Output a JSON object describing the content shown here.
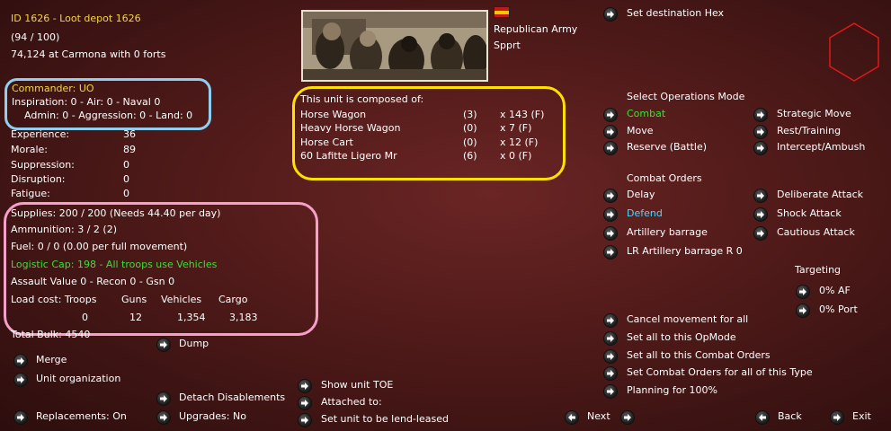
{
  "unit": {
    "id_line": "ID 1626 - Loot depot 1626",
    "strength": "(94 / 100)",
    "location": "74,124 at Carmona with 0 forts"
  },
  "commander": {
    "title": "Commander: UO",
    "line1": "Inspiration: 0 - Air: 0 - Naval 0",
    "line2": "Admin: 0 - Aggression: 0 - Land: 0"
  },
  "stats": [
    {
      "label": "Experience:",
      "value": "36"
    },
    {
      "label": "Morale:",
      "value": "89"
    },
    {
      "label": "Suppression:",
      "value": "0"
    },
    {
      "label": "Disruption:",
      "value": "0"
    },
    {
      "label": "Fatigue:",
      "value": "0"
    }
  ],
  "supply": {
    "supplies": "Supplies: 200 / 200 (Needs 44.40 per day)",
    "ammunition": "Ammunition: 3 / 2 (2)",
    "fuel": "Fuel: 0 / 0 (0.00 per full movement)",
    "logistic": "Logistic Cap: 198 - All troops use Vehicles",
    "assault": "Assault Value 0 - Recon 0 - Gsn 0",
    "load_header": [
      "Load cost: Troops",
      "Guns",
      "Vehicles",
      "Cargo"
    ],
    "load_values": [
      "0",
      "12",
      "1,354",
      "3,183"
    ]
  },
  "total_line": "Total Bulk: 4540",
  "nation": {
    "flag_color_top": "#c0181c",
    "flag_color_mid": "#f0c800",
    "line1": "Republican Army",
    "line2": "Spprt"
  },
  "composition": {
    "title": "This unit is composed of:",
    "rows": [
      {
        "name": "Horse Wagon",
        "count": "(3)",
        "qty": "x 143 (F)"
      },
      {
        "name": "Heavy Horse Wagon",
        "count": "(0)",
        "qty": "x 7 (F)"
      },
      {
        "name": "Horse Cart",
        "count": "(0)",
        "qty": "x 12 (F)"
      },
      {
        "name": "60 Lafitte Ligero Mr",
        "count": "(6)",
        "qty": "x 0 (F)"
      }
    ]
  },
  "left_actions": {
    "dump": "Dump",
    "merge": "Merge",
    "unit_org": "Unit organization",
    "detach": "Detach Disablements",
    "replacements": "Replacements: On",
    "upgrades": "Upgrades: No"
  },
  "mid_actions": {
    "show_toe": "Show unit TOE",
    "attached": "Attached to:",
    "lend_lease": "Set unit to be lend-leased"
  },
  "right": {
    "set_destination": "Set destination Hex",
    "ops_title": "Select Operations Mode",
    "ops_left": [
      "Combat",
      "Move",
      "Reserve (Battle)"
    ],
    "ops_right": [
      "Strategic Move",
      "Rest/Training",
      "Intercept/Ambush"
    ],
    "combat_title": "Combat Orders",
    "combat_left": [
      "Delay",
      "Defend",
      "Artillery barrage",
      "LR Artillery barrage R 0"
    ],
    "combat_right": [
      "Deliberate Attack",
      "Shock Attack",
      "Cautious Attack"
    ],
    "targeting_title": "Targeting",
    "targeting": [
      "0% AF",
      "0% Port"
    ],
    "bulk": [
      "Cancel movement for all",
      "Set all to this OpMode",
      "Set all to this Combat Orders",
      "Set Combat Orders for all of this Type",
      "Planning for  100%"
    ],
    "next": "Next",
    "back": "Back",
    "exit": "Exit"
  },
  "colors": {
    "background": "#4f1a19",
    "title_yellow": "#f5d63c",
    "active_green": "#38e038",
    "selected_cyan": "#50d8ff",
    "frame_blue": "#8fd0f0",
    "frame_yellow": "#ffe000",
    "frame_pink": "#f5a0c8",
    "hex_red": "#e01818"
  }
}
